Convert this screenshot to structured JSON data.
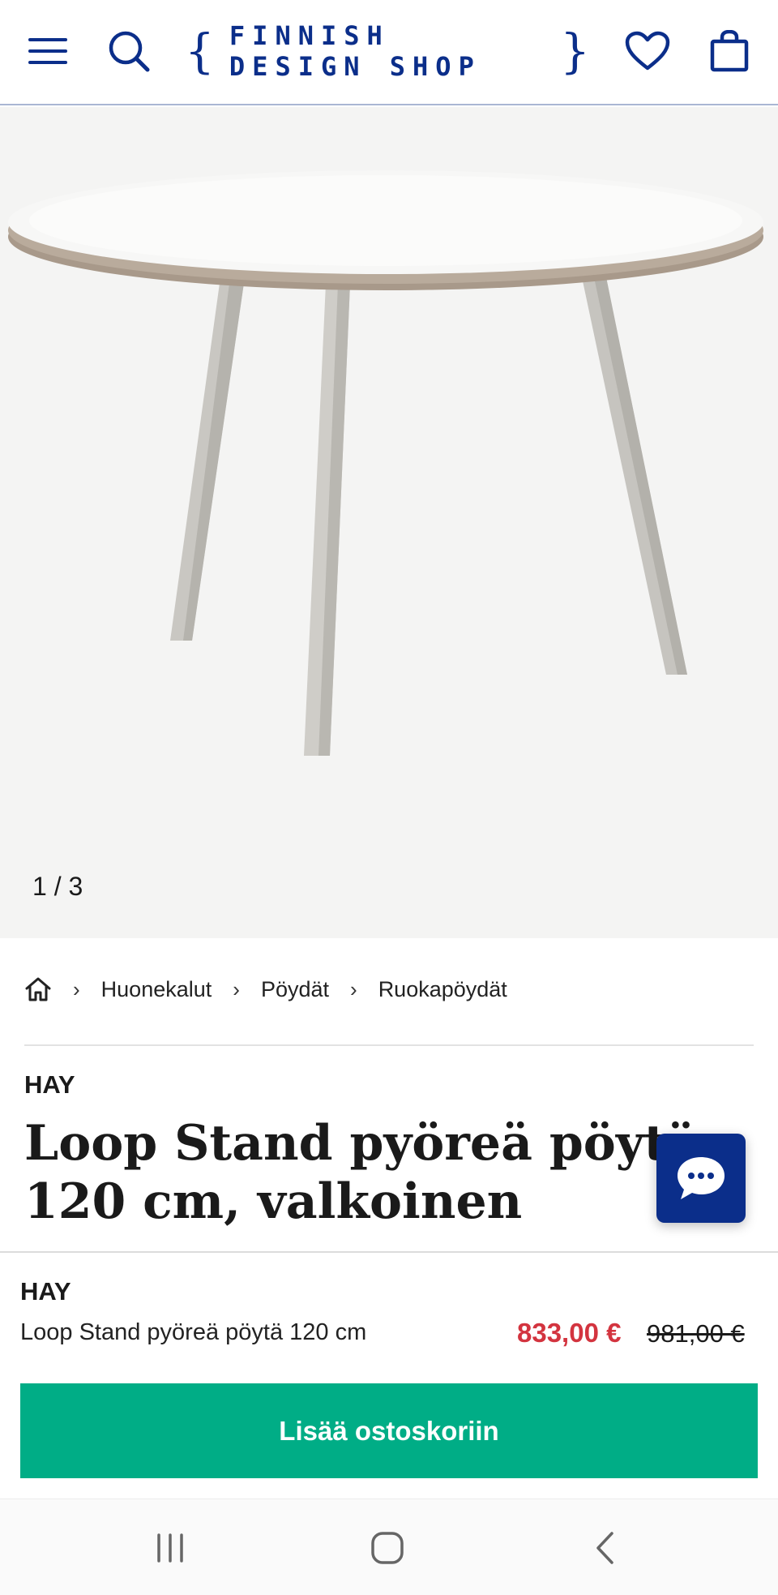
{
  "header": {
    "logo_text": "FINNISH DESIGN SHOP",
    "logo_brace_left": "{",
    "logo_brace_right": "}",
    "icons": [
      "menu-icon",
      "search-icon",
      "heart-icon",
      "shopping-bag-icon"
    ],
    "accent_color": "#0b2e8a"
  },
  "gallery": {
    "counter": "1 / 3"
  },
  "breadcrumb": {
    "items": [
      "Huonekalut",
      "Pöydät",
      "Ruokapöydät"
    ],
    "home_icon": "home-icon",
    "separator": "›"
  },
  "product": {
    "brand": "HAY",
    "title": "Loop Stand pyöreä pöytä 120 cm, valkoinen"
  },
  "sticky": {
    "brand": "HAY",
    "name": "Loop Stand pyöreä pöytä 120 cm",
    "price": "833,00 €",
    "old_price": "981,00 €",
    "cta": "Lisää ostoskoriin",
    "price_color": "#d3343f",
    "cta_color": "#00ad86"
  },
  "chat": {
    "icon": "chat-bubble-icon"
  },
  "system_nav": {
    "icons": [
      "recent-apps-icon",
      "home-button-icon",
      "back-icon"
    ]
  }
}
